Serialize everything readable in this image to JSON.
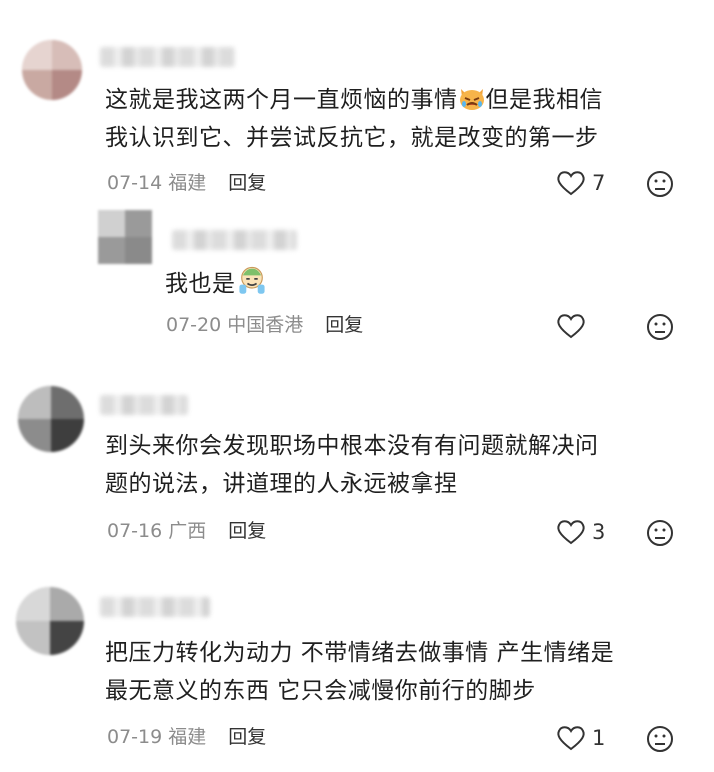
{
  "comments": [
    {
      "text_line1": "这就是我这两个月一直烦恼的事情",
      "text_line1b": "但是我相信",
      "text_line2": "我认识到它、并尝试反抗它，就是改变的第一步",
      "date": "07-14",
      "location": "福建",
      "reply_label": "回复",
      "likes": "7",
      "emoji": "cat-crying-emoji"
    },
    {
      "text": "我也是",
      "date": "07-20",
      "location": "中国香港",
      "reply_label": "回复",
      "likes": "",
      "emoji": "crying-emoji"
    },
    {
      "text_line1": "到头来你会发现职场中根本没有有问题就解决问",
      "text_line2": "题的说法，讲道理的人永远被拿捏",
      "date": "07-16",
      "location": "广西",
      "reply_label": "回复",
      "likes": "3"
    },
    {
      "text_line1": "把压力转化为动力 不带情绪去做事情 产生情绪是",
      "text_line2": "最无意义的东西 它只会减慢你前行的脚步",
      "date": "07-19",
      "location": "福建",
      "reply_label": "回复",
      "likes": "1"
    }
  ],
  "icons": {
    "like": "heart-outline-icon",
    "dislike": "sad-face-icon"
  },
  "colors": {
    "text": "#1f1f1f",
    "meta": "#8c8c8c",
    "reply": "#333333"
  }
}
